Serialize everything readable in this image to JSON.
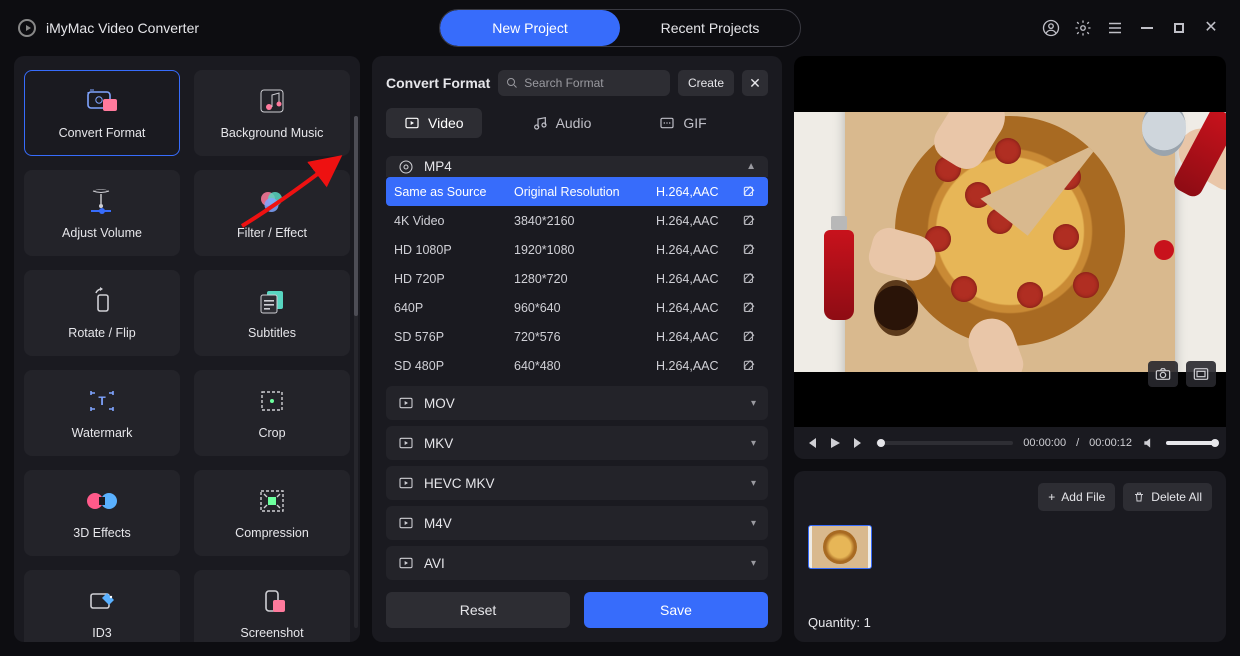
{
  "app": {
    "title": "iMyMac Video Converter"
  },
  "header": {
    "new_project": "New Project",
    "recent_projects": "Recent Projects"
  },
  "sidebar": {
    "tools": [
      {
        "label": "Convert Format",
        "icon": "convert-icon",
        "selected": true
      },
      {
        "label": "Background Music",
        "icon": "music-icon",
        "selected": false
      },
      {
        "label": "Adjust Volume",
        "icon": "volume-icon",
        "selected": false
      },
      {
        "label": "Filter / Effect",
        "icon": "filter-icon",
        "selected": false
      },
      {
        "label": "Rotate / Flip",
        "icon": "rotate-icon",
        "selected": false
      },
      {
        "label": "Subtitles",
        "icon": "subtitles-icon",
        "selected": false
      },
      {
        "label": "Watermark",
        "icon": "watermark-icon",
        "selected": false
      },
      {
        "label": "Crop",
        "icon": "crop-icon",
        "selected": false
      },
      {
        "label": "3D Effects",
        "icon": "3d-icon",
        "selected": false
      },
      {
        "label": "Compression",
        "icon": "compress-icon",
        "selected": false
      },
      {
        "label": "ID3",
        "icon": "id3-icon",
        "selected": false
      },
      {
        "label": "Screenshot",
        "icon": "screenshot-icon",
        "selected": false
      }
    ]
  },
  "formats": {
    "title": "Convert Format",
    "search_placeholder": "Search Format",
    "create_label": "Create",
    "tabs": [
      {
        "label": "Video",
        "active": true
      },
      {
        "label": "Audio",
        "active": false
      },
      {
        "label": "GIF",
        "active": false
      }
    ],
    "open_container": {
      "name": "MP4",
      "presets": [
        {
          "name": "Same as Source",
          "resolution": "Original Resolution",
          "codec": "H.264,AAC",
          "selected": true
        },
        {
          "name": "4K Video",
          "resolution": "3840*2160",
          "codec": "H.264,AAC",
          "selected": false
        },
        {
          "name": "HD 1080P",
          "resolution": "1920*1080",
          "codec": "H.264,AAC",
          "selected": false
        },
        {
          "name": "HD 720P",
          "resolution": "1280*720",
          "codec": "H.264,AAC",
          "selected": false
        },
        {
          "name": "640P",
          "resolution": "960*640",
          "codec": "H.264,AAC",
          "selected": false
        },
        {
          "name": "SD 576P",
          "resolution": "720*576",
          "codec": "H.264,AAC",
          "selected": false
        },
        {
          "name": "SD 480P",
          "resolution": "640*480",
          "codec": "H.264,AAC",
          "selected": false
        }
      ]
    },
    "other_containers": [
      "MOV",
      "MKV",
      "HEVC MKV",
      "M4V",
      "AVI"
    ],
    "reset_label": "Reset",
    "save_label": "Save"
  },
  "player": {
    "current_time": "00:00:00",
    "total_time": "00:00:12",
    "time_separator": " / "
  },
  "filelist": {
    "add_file_label": "Add File",
    "delete_all_label": "Delete All",
    "quantity_label": "Quantity: 1"
  },
  "colors": {
    "accent": "#376cfb"
  }
}
